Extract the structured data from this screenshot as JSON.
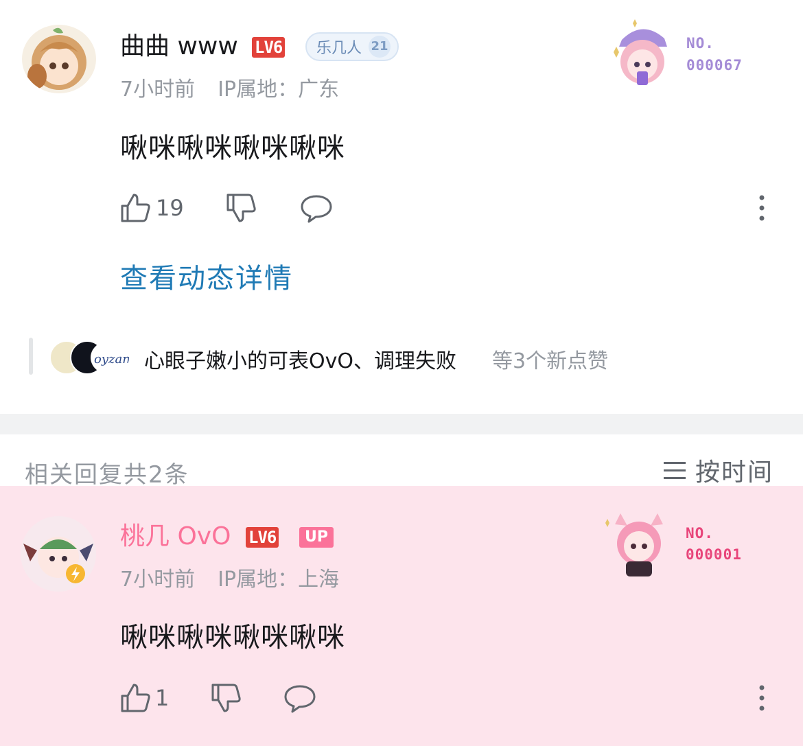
{
  "comment": {
    "user_name": "曲曲 www",
    "level_badge": "LV6",
    "fan_badge": {
      "name": "乐几人",
      "level": "21"
    },
    "time": "7小时前",
    "ip_location": "IP属地：广东",
    "text": "啾咪啾咪啾咪啾咪",
    "like_count": "19",
    "detail_link": "查看动态详情",
    "card_number_prefix": "NO.",
    "card_number": "000067",
    "liked_by_names": "心眼子嫩小的可表OvO、调理失败",
    "liked_by_suffix": "等3个新点赞",
    "icons": [
      "thumb-up-icon",
      "thumb-down-icon",
      "comment-icon",
      "more-vertical-icon"
    ]
  },
  "replies_header": {
    "title": "相关回复共2条",
    "sort_label": "按时间",
    "sort_icon": "list-sort-icon"
  },
  "reply": {
    "user_name": "桃几 OvO",
    "level_badge": "LV6",
    "up_tag": "UP",
    "time": "7小时前",
    "ip_location": "IP属地：上海",
    "text": "啾咪啾咪啾咪啾咪",
    "like_count": "1",
    "card_number_prefix": "NO.",
    "card_number": "000001"
  },
  "colors": {
    "accent_link": "#1f7ab5",
    "level_red": "#e2423a",
    "pink": "#fb7299",
    "purple_number": "#a48bd6",
    "pink_number": "#e8457a",
    "reply_bg": "#fde4ec"
  }
}
